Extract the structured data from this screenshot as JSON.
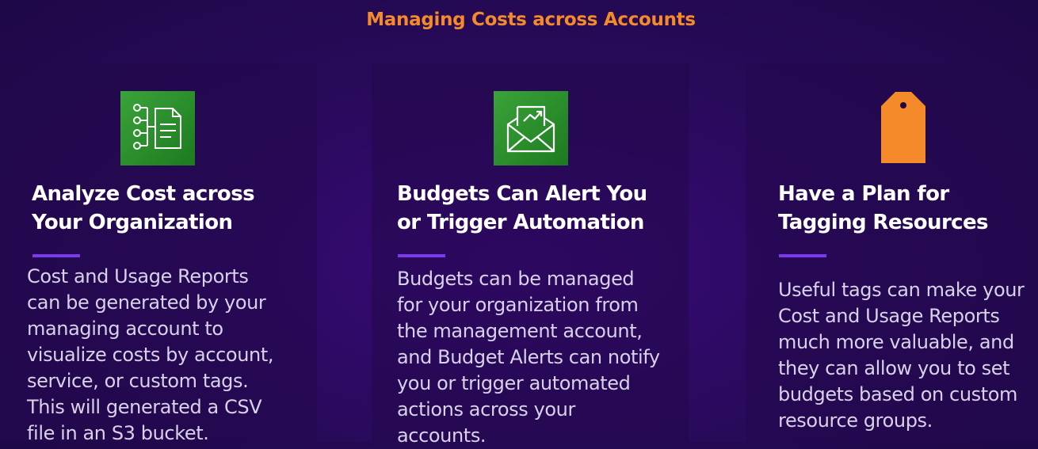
{
  "slide": {
    "title": "Managing Costs across Accounts"
  },
  "colors": {
    "title": "#f58a2a",
    "accent_bar": "#7a3af0",
    "icon_green": "#2a8f2c",
    "tag_orange": "#f58a2a"
  },
  "cards": [
    {
      "icon": "cost-report-icon",
      "heading_lines": [
        "Analyze Cost across",
        "Your Organization"
      ],
      "body_lines": [
        "Cost and Usage Reports",
        "can be generated by your",
        "managing account to",
        "visualize costs by account,",
        "service, or custom tags.",
        "This will generated a CSV",
        "file in an S3 bucket."
      ]
    },
    {
      "icon": "budget-alert-envelope-icon",
      "heading_lines": [
        "Budgets Can Alert You",
        "or Trigger Automation"
      ],
      "body_lines": [
        "Budgets can be managed",
        "for your organization from",
        "the management account,",
        "and Budget Alerts can notify",
        "you or trigger automated",
        "actions across your",
        "accounts."
      ]
    },
    {
      "icon": "tag-icon",
      "heading_lines": [
        "Have a Plan for",
        "Tagging Resources"
      ],
      "body_lines": [
        "Useful tags can make your",
        "Cost and Usage Reports",
        "much more valuable, and",
        "they can allow you to set",
        "budgets based on custom",
        "resource groups."
      ]
    }
  ]
}
